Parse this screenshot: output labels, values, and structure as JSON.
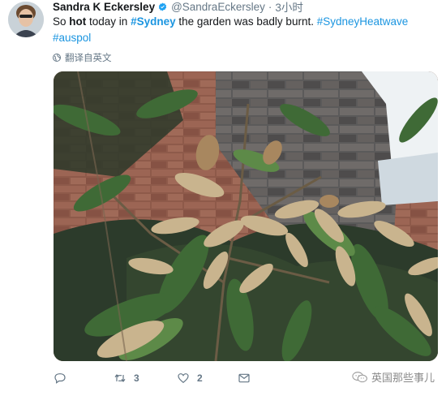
{
  "author": {
    "display_name": "Sandra K Eckersley",
    "handle": "@SandraEckersley",
    "separator": "·",
    "time": "3小时"
  },
  "tweet": {
    "t1": "So ",
    "t2": "hot",
    "t3": " today in ",
    "t4": "#Sydney",
    "t5": " the garden was badly burnt. ",
    "t6": "#SydneyHeatwave",
    "t7": "#auspol"
  },
  "translate_label": "翻译自英文",
  "actions": {
    "retweet_count": "3",
    "like_count": "2"
  },
  "watermark": "英国那些事儿",
  "colors": {
    "hashtag": "#1b95e0",
    "verified": "#1da1f2",
    "secondary": "#657786"
  },
  "icons": [
    "verified-badge-icon",
    "globe-icon",
    "reply-icon",
    "retweet-icon",
    "like-icon",
    "direct-message-icon",
    "wechat-icon"
  ]
}
